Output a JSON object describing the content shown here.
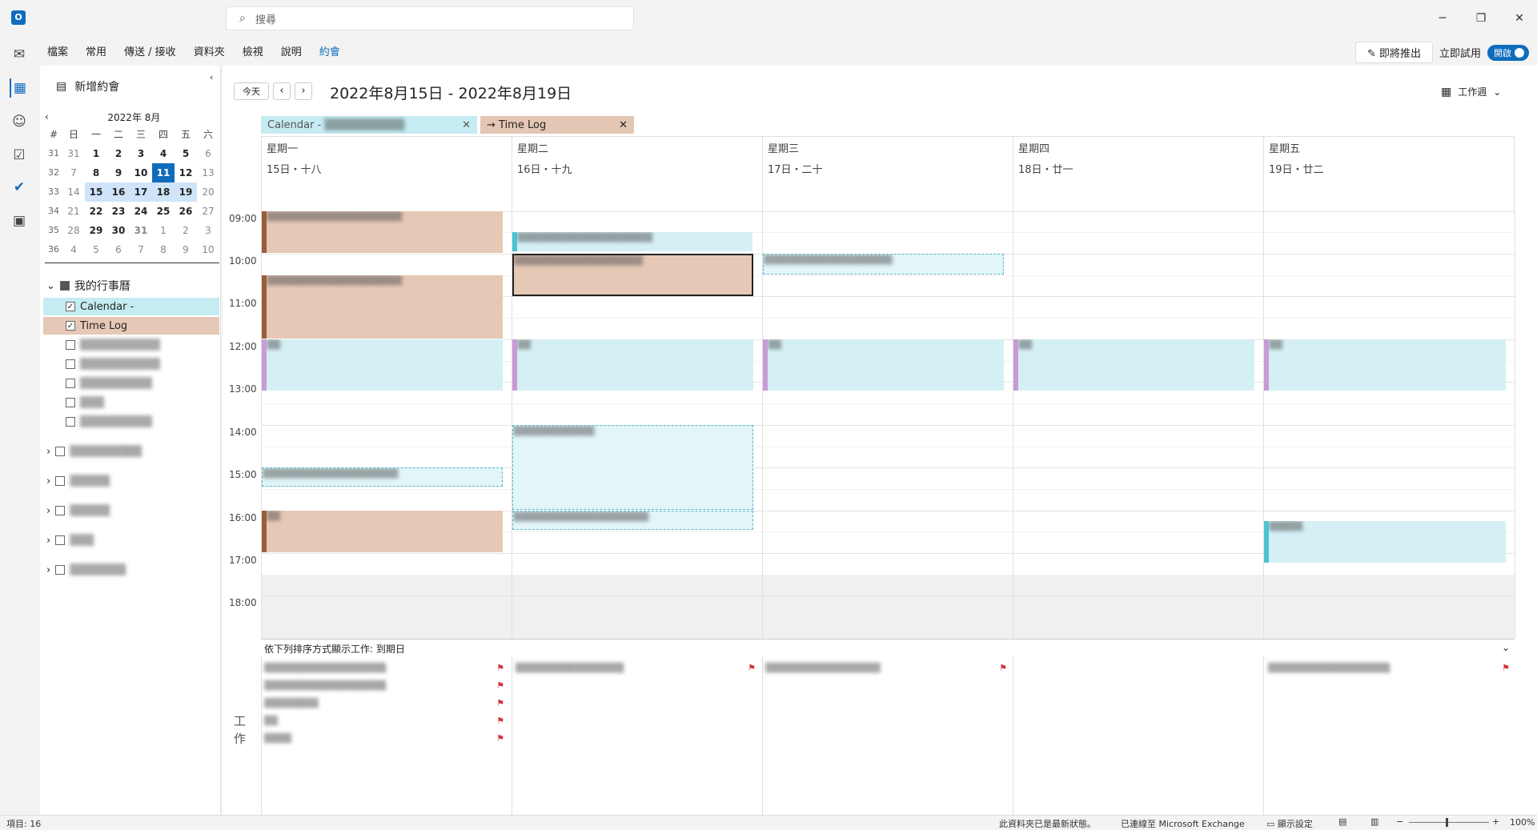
{
  "app": {
    "search_placeholder": "搜尋"
  },
  "ribbon": {
    "tabs": [
      "檔案",
      "常用",
      "傳送 / 接收",
      "資料夾",
      "檢視",
      "說明",
      "約會"
    ]
  },
  "ribbon_right": {
    "coming_soon": "即將推出",
    "try_now": "立即試用",
    "toggle_label": "開啟"
  },
  "nav": {
    "new_appointment": "新增約會",
    "month_title": "2022年 8月",
    "week_header": [
      "#",
      "日",
      "一",
      "二",
      "三",
      "四",
      "五",
      "六"
    ],
    "weeks": [
      [
        "31",
        "31",
        "1",
        "2",
        "3",
        "4",
        "5",
        "6"
      ],
      [
        "32",
        "7",
        "8",
        "9",
        "10",
        "11",
        "12",
        "13"
      ],
      [
        "33",
        "14",
        "15",
        "16",
        "17",
        "18",
        "19",
        "20"
      ],
      [
        "34",
        "21",
        "22",
        "23",
        "24",
        "25",
        "26",
        "27"
      ],
      [
        "35",
        "28",
        "29",
        "30",
        "31",
        "1",
        "2",
        "3"
      ],
      [
        "36",
        "4",
        "5",
        "6",
        "7",
        "8",
        "9",
        "10"
      ]
    ],
    "my_calendars": "我的行事曆",
    "calendar_item": "Calendar -",
    "timelog_item": "Time Log"
  },
  "toolbar": {
    "today": "今天",
    "range": "2022年8月15日 - 2022年8月19日",
    "view": "工作週"
  },
  "tabs": {
    "calendar": "Calendar -",
    "timelog": "Time Log"
  },
  "days": [
    {
      "name": "星期一",
      "date": "15日・十八"
    },
    {
      "name": "星期二",
      "date": "16日・十九"
    },
    {
      "name": "星期三",
      "date": "17日・二十"
    },
    {
      "name": "星期四",
      "date": "18日・廿一"
    },
    {
      "name": "星期五",
      "date": "19日・廿二"
    }
  ],
  "hours": [
    "09:00",
    "10:00",
    "11:00",
    "12:00",
    "13:00",
    "14:00",
    "15:00",
    "16:00",
    "17:00",
    "18:00"
  ],
  "tasks": {
    "sort_label": "依下列排序方式顯示工作: 到期日",
    "label": "工作"
  },
  "status": {
    "items": "項目: 16",
    "uptodate": "此資料夾已是最新狀態。",
    "connected": "已連線至 Microsoft Exchange",
    "display": "顯示設定",
    "zoom": "100%"
  },
  "colors": {
    "accent": "#0f6cbd",
    "timelog": "#e6c8b6",
    "calendar": "#d5f0f5"
  }
}
